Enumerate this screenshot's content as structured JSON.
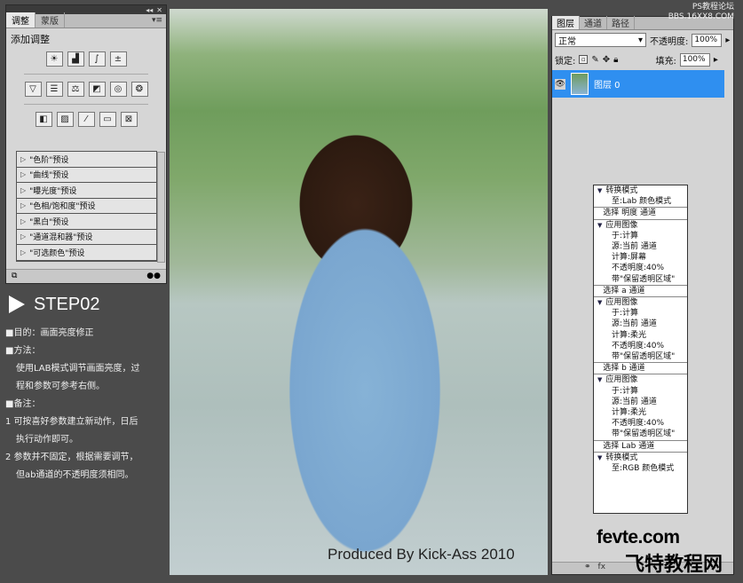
{
  "adjust_panel": {
    "tabs": [
      "调整",
      "蒙版"
    ],
    "title": "添加调整",
    "icon_row1": [
      "brightness-icon",
      "levels-icon",
      "curves-icon",
      "exposure-icon"
    ],
    "icon_row2": [
      "vibrance-icon",
      "hue-sat-icon",
      "color-balance-icon",
      "black-white-icon",
      "photo-filter-icon",
      "channel-mixer-icon"
    ],
    "icon_row3": [
      "invert-icon",
      "posterize-icon",
      "threshold-icon",
      "gradient-map-icon",
      "selective-color-icon"
    ],
    "presets": [
      "\"色阶\"预设",
      "\"曲线\"预设",
      "\"曝光度\"预设",
      "\"色相/饱和度\"预设",
      "\"黑白\"预设",
      "\"通道混和器\"预设",
      "\"可选颜色\"预设"
    ]
  },
  "step": {
    "title": "STEP02",
    "purpose": "■目的：画面亮度修正",
    "method_head": "■方法：",
    "method_body1": "使用LAB模式调节画面亮度，过",
    "method_body2": "程和参数可参考右侧。",
    "note_head": "■备注：",
    "note1a": "1 可按喜好参数建立新动作，日后",
    "note1b": "执行动作即可。",
    "note2a": "2 参数并不固定，根据需要调节，",
    "note2b": "但ab通道的不透明度须相同。"
  },
  "photo": {
    "credit": "Produced By Kick-Ass 2010"
  },
  "layers_panel": {
    "tabs": [
      "图层",
      "通道",
      "路径"
    ],
    "blend_mode": "正常",
    "opacity_label": "不透明度:",
    "opacity_value": "100%",
    "lock_label": "锁定:",
    "fill_label": "填充:",
    "fill_value": "100%",
    "layer_name": "图层 0"
  },
  "actions": {
    "a1_head": "转换模式",
    "a1_d1": "至:Lab 颜色模式",
    "a2_head": "选择 明度 通道",
    "a3_head": "应用图像",
    "a3_d1": "于:计算",
    "a3_d2": "源:当前 通道",
    "a3_d3": "计算:屏幕",
    "a3_d4": "不透明度:40%",
    "a3_d5": "带\"保留透明区域\"",
    "a4_head": "选择 a 通道",
    "a5_head": "应用图像",
    "a5_d1": "于:计算",
    "a5_d2": "源:当前 通道",
    "a5_d3": "计算:柔光",
    "a5_d4": "不透明度:40%",
    "a5_d5": "带\"保留透明区域\"",
    "a6_head": "选择 b 通道",
    "a7_head": "应用图像",
    "a7_d1": "于:计算",
    "a7_d2": "源:当前 通道",
    "a7_d3": "计算:柔光",
    "a7_d4": "不透明度:40%",
    "a7_d5": "带\"保留透明区域\"",
    "a8_head": "选择 Lab 通道",
    "a9_head": "转换模式",
    "a9_d1": "至:RGB 颜色模式"
  },
  "watermark": {
    "line1": "PS教程论坛",
    "line2": "BBS.16XX8.COM",
    "brand1": "fevte.com",
    "brand2": "飞特教程网"
  }
}
